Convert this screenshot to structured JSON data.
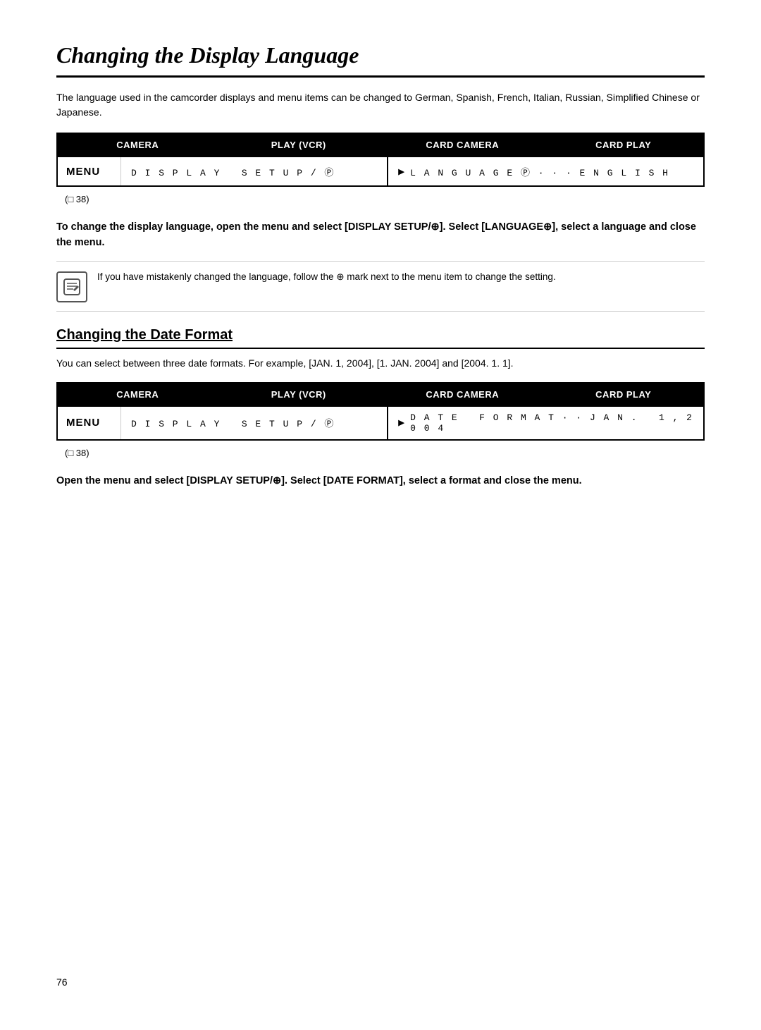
{
  "page": {
    "title": "Changing the Display Language",
    "page_number": "76"
  },
  "section1": {
    "intro": "The language used in the camcorder displays and menu items can be changed to German, Spanish, French, Italian, Russian, Simplified Chinese or Japanese.",
    "mode_bar": {
      "camera": "CAMERA",
      "play_vcr": "PLAY (VCR)",
      "card_camera": "CARD CAMERA",
      "card_play": "CARD PLAY"
    },
    "menu_label": "MENU",
    "menu_left": "DISPLAY SETUP / ⊕",
    "menu_right": "LANGUAGE⊕···ENGLISH",
    "menu_ref": "(□ 38)",
    "instruction": "To change the display language, open the menu and select [DISPLAY SETUP/⊕]. Select [LANGUAGE⊕], select a language and close the menu.",
    "note_text": "If you have mistakenly changed the language, follow the ⊕ mark next to the menu item to change the setting."
  },
  "section2": {
    "heading": "Changing the Date Format",
    "intro": "You can select between three date formats. For example, [JAN. 1, 2004], [1. JAN. 2004] and [2004. 1. 1].",
    "mode_bar": {
      "camera": "CAMERA",
      "play_vcr": "PLAY (VCR)",
      "card_camera": "CARD CAMERA",
      "card_play": "CARD PLAY"
    },
    "menu_label": "MENU",
    "menu_left": "DISPLAY SETUP / ⊕",
    "menu_right": "DATE FORMAT··JAN. 1,2004",
    "menu_ref": "(□ 38)",
    "instruction": "Open the menu and select [DISPLAY SETUP/⊕]. Select [DATE FORMAT], select a format and close the menu."
  }
}
